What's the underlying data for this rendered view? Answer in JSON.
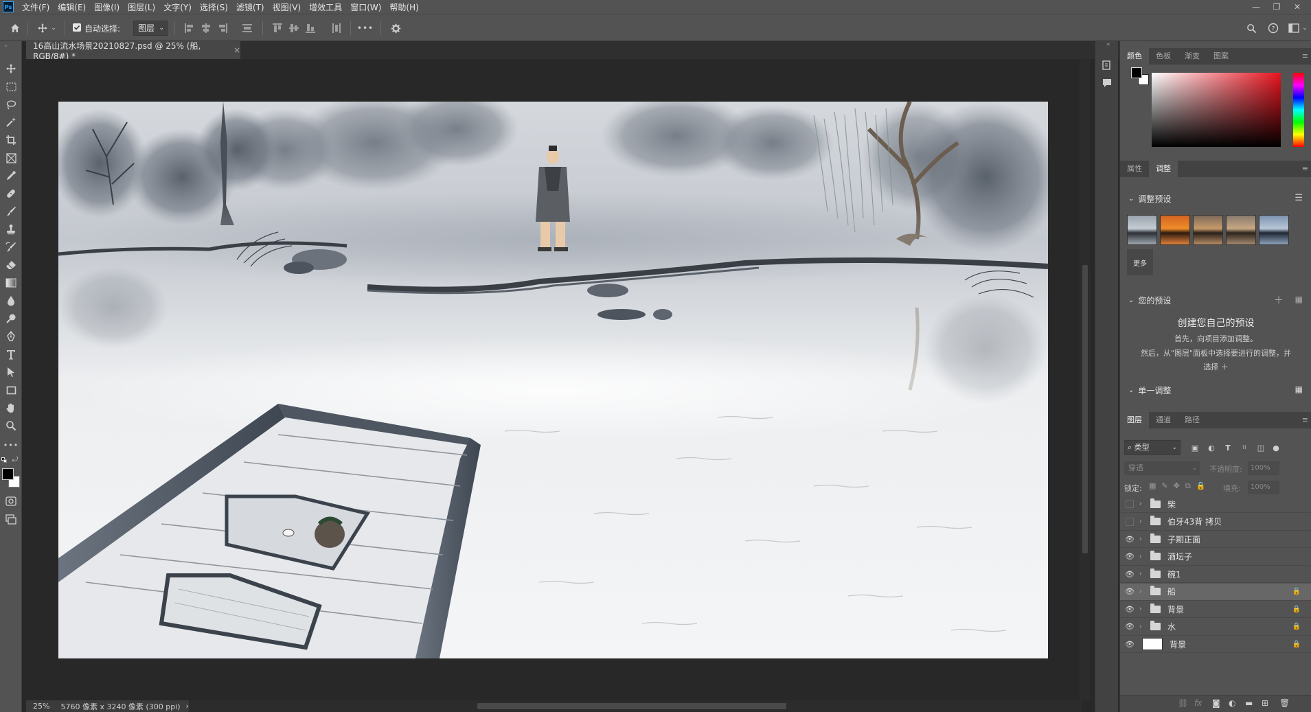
{
  "app": {
    "logo_text": "Ps",
    "menu": [
      "文件(F)",
      "编辑(E)",
      "图像(I)",
      "图层(L)",
      "文字(Y)",
      "选择(S)",
      "滤镜(T)",
      "视图(V)",
      "增效工具",
      "窗口(W)",
      "帮助(H)"
    ],
    "window_controls": {
      "minimize": "—",
      "restore": "❐",
      "close": "✕"
    }
  },
  "options_bar": {
    "auto_select_label": "自动选择:",
    "auto_select_checked": true,
    "auto_select_target": "图层",
    "more": "•••"
  },
  "document": {
    "tab_title": "16高山流水场景20210827.psd @ 25% (船, RGB/8#) *",
    "tab_close": "×"
  },
  "status": {
    "zoom": "25%",
    "dimensions": "5760 像素 x 3240 像素 (300 ppi)",
    "arrow": "›"
  },
  "panels": {
    "color_tabs": [
      "颜色",
      "色板",
      "渐变",
      "图案"
    ],
    "props_tabs": [
      "属性",
      "调整"
    ],
    "adjust_presets_title": "调整预设",
    "more_label": "更多",
    "your_presets_title": "您的预设",
    "create_title": "创建您自己的预设",
    "create_line1": "首先，向项目添加调整。",
    "create_line2": "然后，从\"图层\"面板中选择要进行的调整，并",
    "create_line3": "选择 ＋",
    "single_adjust_title": "单一调整",
    "layers_tabs": [
      "图层",
      "通道",
      "路径"
    ],
    "filter_kind": "类型",
    "blend_mode": "穿透",
    "opacity_label": "不透明度:",
    "opacity_value": "100%",
    "lock_label": "锁定:",
    "fill_label": "填充:",
    "fill_value": "100%"
  },
  "layers": [
    {
      "name": "柴",
      "visible": false,
      "type": "group",
      "locked": false,
      "selected": false
    },
    {
      "name": "伯牙43背 拷贝",
      "visible": false,
      "type": "group",
      "locked": false,
      "selected": false
    },
    {
      "name": "子期正面",
      "visible": true,
      "type": "group",
      "locked": false,
      "selected": false
    },
    {
      "name": "酒坛子",
      "visible": true,
      "type": "group",
      "locked": false,
      "selected": false
    },
    {
      "name": "碗1",
      "visible": true,
      "type": "group",
      "locked": false,
      "selected": false
    },
    {
      "name": "船",
      "visible": true,
      "type": "group",
      "locked": true,
      "selected": true
    },
    {
      "name": "背景",
      "visible": true,
      "type": "group",
      "locked": true,
      "selected": false
    },
    {
      "name": "水",
      "visible": true,
      "type": "group",
      "locked": true,
      "selected": false
    },
    {
      "name": "背景",
      "visible": true,
      "type": "pixel",
      "locked": true,
      "selected": false
    }
  ],
  "colors": {
    "foreground": "#000000",
    "background": "#ffffff"
  }
}
